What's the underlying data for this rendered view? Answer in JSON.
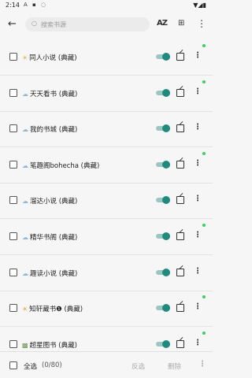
{
  "status_bar": {
    "time": "2:14",
    "left_icons": "A ▪ ◌",
    "right_icons": "▼◢▮"
  },
  "app_bar": {
    "back_icon": "←",
    "search_icon": "○",
    "search_placeholder": "搜索书源",
    "sort_label": "AZ",
    "group_icon": "⊞",
    "more_icon": "⋮"
  },
  "sources": [
    {
      "icon": "☀",
      "icon_color": "#e8b23a",
      "name": "同人小说 (典藏)",
      "enabled": true,
      "has_update_dot": true
    },
    {
      "icon": "☁",
      "icon_color": "#8fb7d6",
      "name": "天天看书 (典藏)",
      "enabled": true,
      "has_update_dot": true
    },
    {
      "icon": "☁",
      "icon_color": "#8fb7d6",
      "name": "我的书城 (典藏)",
      "enabled": true,
      "has_update_dot": false
    },
    {
      "icon": "☁",
      "icon_color": "#8fb7d6",
      "name": "笔趣阁bohecha (典藏)",
      "enabled": true,
      "has_update_dot": true
    },
    {
      "icon": "☁",
      "icon_color": "#8fb7d6",
      "name": "溜达小说 (典藏)",
      "enabled": true,
      "has_update_dot": false
    },
    {
      "icon": "☁",
      "icon_color": "#8fb7d6",
      "name": "精华书阁 (典藏)",
      "enabled": true,
      "has_update_dot": true
    },
    {
      "icon": "☁",
      "icon_color": "#8fb7d6",
      "name": "趣读小说 (典藏)",
      "enabled": true,
      "has_update_dot": false
    },
    {
      "icon": "☀",
      "icon_color": "#e8a23a",
      "name": "知轩藏书❶ (典藏)",
      "enabled": true,
      "has_update_dot": true
    },
    {
      "icon": "▩",
      "icon_color": "#6a8f4a",
      "name": "超星图书 (典藏)",
      "enabled": true,
      "has_update_dot": true
    }
  ],
  "row_actions": {
    "edit_icon": "edit",
    "more_icon": "⋮"
  },
  "bottom_bar": {
    "select_all_label": "全选",
    "selected_count": "(0/80)",
    "invert_label": "反选",
    "delete_label": "删除",
    "more_icon": "⋮"
  },
  "colors": {
    "accent": "#208a7f",
    "accent_track": "#9bc6c1",
    "update_dot": "#3bd15a"
  }
}
